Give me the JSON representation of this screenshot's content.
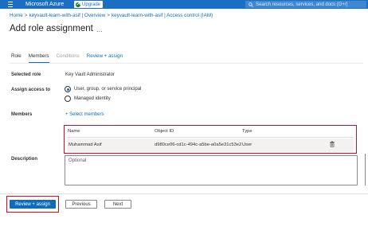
{
  "topbar": {
    "brand": "Microsoft Azure",
    "upgrade_label": "Upgrade",
    "search_placeholder": "Search resources, services, and docs (G+/)"
  },
  "breadcrumb": [
    "Home",
    "keyvault-learn-with-asif | Overview",
    "keyvault-learn-with-asif | Access control (IAM)"
  ],
  "page": {
    "title": "Add role assignment",
    "more": "..."
  },
  "tabs": [
    {
      "label": "Role"
    },
    {
      "label": "Members"
    },
    {
      "label": "Conditions"
    },
    {
      "label": "Review + assign"
    }
  ],
  "form": {
    "selected_role_label": "Selected role",
    "selected_role_value": "Key Vault Administrator",
    "assign_access_label": "Assign access to",
    "options": [
      {
        "label": "User, group, or service principal",
        "checked": true
      },
      {
        "label": "Managed identity",
        "checked": false
      }
    ],
    "members_label": "Members",
    "select_members_link": "+ Select members",
    "table": {
      "headers": [
        "Name",
        "Object ID",
        "Type"
      ],
      "rows": [
        {
          "name": "Muhammad Asif",
          "object_id": "d980ce06-cd1c-494c-a5be-a0a5e31c53e2",
          "type": "User"
        }
      ]
    },
    "description_label": "Description",
    "description_placeholder": "Optional"
  },
  "footer": {
    "review_assign": "Review + assign",
    "previous": "Previous",
    "next": "Next"
  },
  "colors": {
    "topbar": "#1b6ec2",
    "accent": "#0f6cbd",
    "highlight": "#c8102e"
  }
}
